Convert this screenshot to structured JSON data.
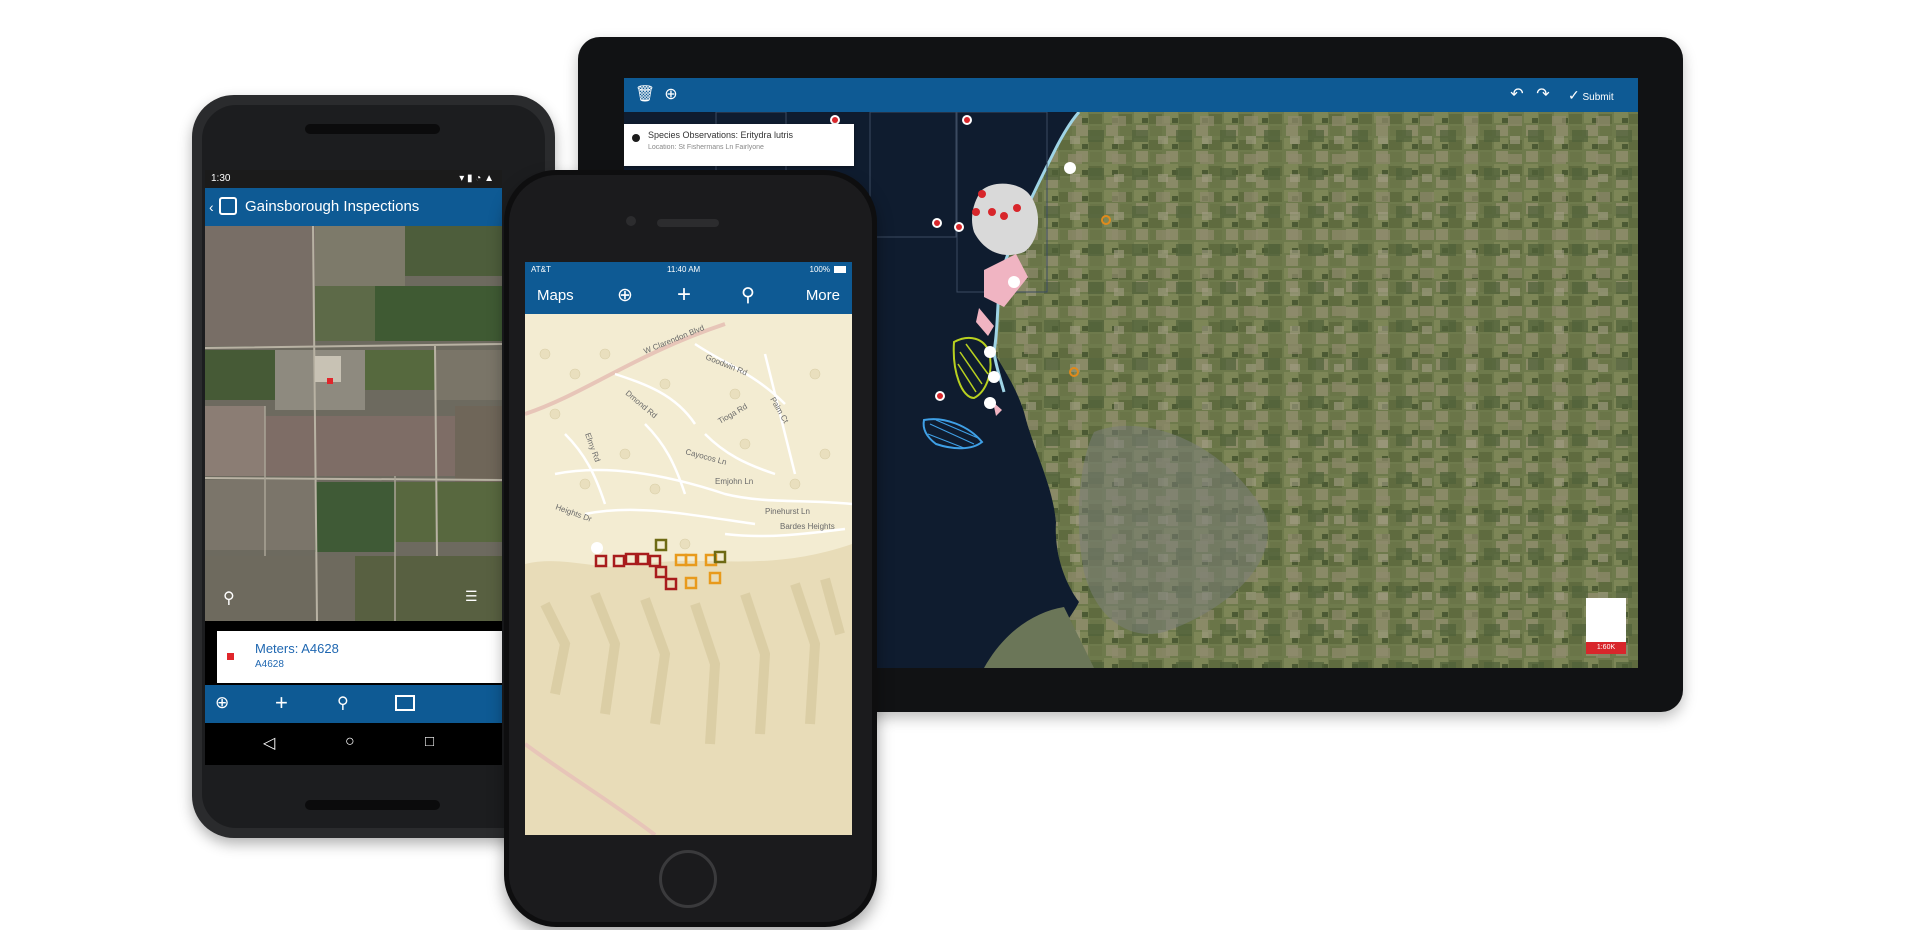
{
  "tablet": {
    "toolbar": {
      "left_icons": [
        "trash-icon",
        "locate-icon"
      ],
      "right_icons": [
        "undo-icon",
        "redo-icon"
      ],
      "submit_label": "Submit"
    },
    "callout": {
      "title": "Species Observations: Eritydra lutris",
      "subtitle": "Location: St Fishermans Ln Fairlyone"
    },
    "corner_label": "1:60K"
  },
  "android": {
    "status_left": "1:30",
    "title": "Gainsborough Inspections",
    "card": {
      "title": "Meters: A4628",
      "subtitle": "A4628"
    },
    "toolbar_icons": [
      "locate-icon",
      "add-icon",
      "search-icon",
      "map-icon"
    ],
    "nav_icons": [
      "back-icon",
      "home-icon",
      "recents-icon"
    ]
  },
  "iphone": {
    "status": {
      "carrier": "AT&T",
      "time": "11:40 AM",
      "battery": "100%"
    },
    "nav": {
      "maps_label": "Maps",
      "more_label": "More"
    },
    "streets": [
      {
        "name": "W Clarendon Blvd"
      },
      {
        "name": "Goodwin Rd"
      },
      {
        "name": "Cayocos Ln"
      },
      {
        "name": "Emjohn Ln"
      },
      {
        "name": "Pinehurst Ln"
      },
      {
        "name": "Palm Ct"
      },
      {
        "name": "Bardes Heights"
      },
      {
        "name": "Heights Dr"
      },
      {
        "name": "Dmond Rd"
      },
      {
        "name": "Tioga Rd"
      },
      {
        "name": "Elmy Rd"
      }
    ]
  },
  "colors": {
    "brand_blue": "#0e5a94",
    "marker_red": "#a81c1c",
    "marker_orange": "#e89a1c",
    "marker_olive": "#6e6a14"
  }
}
